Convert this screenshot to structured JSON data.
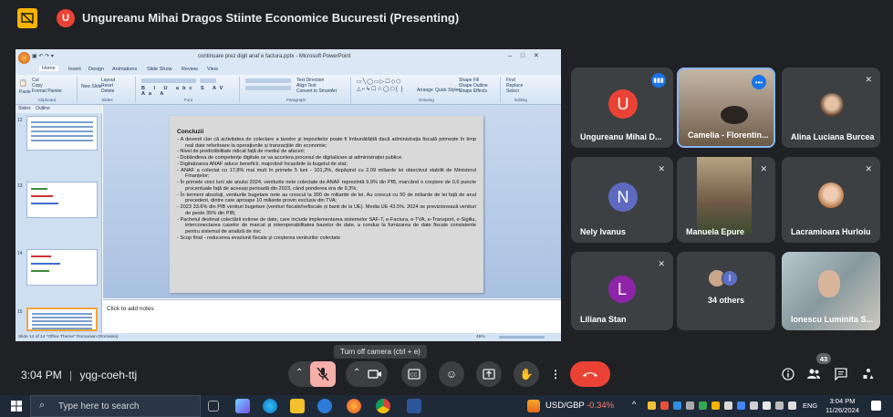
{
  "meeting": {
    "presenting_title": "Ungureanu Mihai Dragos Stiinte Economice Bucuresti (Presenting)",
    "presenter_initial": "U",
    "time": "3:04 PM",
    "separator": "|",
    "meeting_code": "yqg-coeh-ttj",
    "tooltip": "Turn off camera (ctrl + e)",
    "people_count": "43"
  },
  "powerpoint": {
    "window_title": "continuare prez digit anaf e factura.pptx - Microsoft PowerPoint",
    "tabs": [
      "Home",
      "Insert",
      "Design",
      "Animations",
      "Slide Show",
      "Review",
      "View"
    ],
    "ribbon_groups": [
      "Clipboard",
      "Slides",
      "Font",
      "Paragraph",
      "Drawing",
      "Editing"
    ],
    "ribbon_buttons": {
      "paste": "Paste",
      "cut": "Cut",
      "copy": "Copy",
      "format_painter": "Format Painter",
      "new_slide": "New Slide",
      "layout": "Layout",
      "reset": "Reset",
      "delete": "Delete",
      "find": "Find",
      "replace": "Replace",
      "select": "Select",
      "arrange": "Arrange",
      "quick_styles": "Quick Styles",
      "shape_fill": "Shape Fill",
      "shape_outline": "Shape Outline",
      "shape_effects": "Shape Effects",
      "text_direction": "Text Direction",
      "align_text": "Align Text",
      "convert_smartart": "Convert to SmartArt"
    },
    "left_tabs": {
      "slides": "Slides",
      "outline": "Outline"
    },
    "thumb_numbers": [
      "12",
      "13",
      "14",
      "15"
    ],
    "notes_placeholder": "Click to add notes",
    "status_text": "Slide 14 of 14   \"Office Theme\"   Romanian (Romania)",
    "zoom": "45%"
  },
  "slide": {
    "title": "Concluzii",
    "lines": [
      "-   A devenit clar că activitatea de colectare a taxelor și impozitelor poate fi îmbunătățită dacă administrația fiscală primește în timp real date referitoare la operațiunile și tranzacțiile din economie;",
      "- Nivel de predictibilitate ridicat față de mediul de afaceri;",
      "-   Dobândirea de competențe digitale ce va accelera procesul de digitalizare al administrației publice.",
      "-   Digitalizarea ANAF aduce beneficii, majorând încasările la bugetul de stat;",
      "-   ANAF a colectat cu 17,8% mai mult în primele 5 luni - 101,2%, depășind cu 2,09 miliarde lei obiectivul stabilit de Ministerul Finanțelor;",
      "-   În primele cinci luni ale anului 2024, veniturile nete colectate de ANAF reprezintă 9,9% din PIB, marcând o creștere de 0,6 puncte procentuale față de aceeași perioadă din 2023, când ponderea era de 9,3%;",
      "-   În termeni absoluți, veniturile bugetare nete au crescut la 300 de miliarde de lei. Au crescut cu 50 de miliarde de lei față de anul precedent, dintre care aproape 10 miliarde provin exclusiv din TVA;",
      "-   2023 33.6% din PIB venituri bugetare (venituri fiscale/nefiscale și banii de la UE). Media UE 43.5%. 2024 se previzionează venituri de peste 35% din PIB;",
      "-   Pachetul destinat colectării extinse de date, care include implementarea sistemelor SAF-T, e-Factura, e-TVA, e-Transport, e-Sigiliu, interconectarea caselor de marcat și interoperabilitatea bazelor de date, a condus la furnizarea de date fiscale consistente pentru sistemul de analiză de risc",
      "-   Scop final - reducerea evaziunii fiscale și creșterea veniturilor colectate"
    ]
  },
  "participants": [
    {
      "name": "Ungureanu Mihai D...",
      "initial": "U",
      "color": "#ea4335"
    },
    {
      "name": "Camelia - Florentin..."
    },
    {
      "name": "Alina Luciana Burcea"
    },
    {
      "name": "Nely Ivanus",
      "initial": "N",
      "color": "#5c6bc0"
    },
    {
      "name": "Manuela Epure"
    },
    {
      "name": "Lacramioara Hurloiu"
    },
    {
      "name": "Liliana Stan",
      "initial": "L",
      "color": "#8e24aa"
    },
    {
      "name": "34 others",
      "initial": "I"
    },
    {
      "name": "Ionescu Luminita S..."
    }
  ],
  "taskbar": {
    "search_placeholder": "Type here to search",
    "ticker": "USD/GBP",
    "ticker_change": "-0.34%",
    "language": "ENG",
    "time": "3:04 PM",
    "date": "11/26/2024"
  },
  "colors": {
    "end_call": "#ea4335",
    "mic_off": "#f6aea9",
    "active_speaker": "#8ab4f8",
    "background": "#202124",
    "tile": "#3c4043"
  }
}
